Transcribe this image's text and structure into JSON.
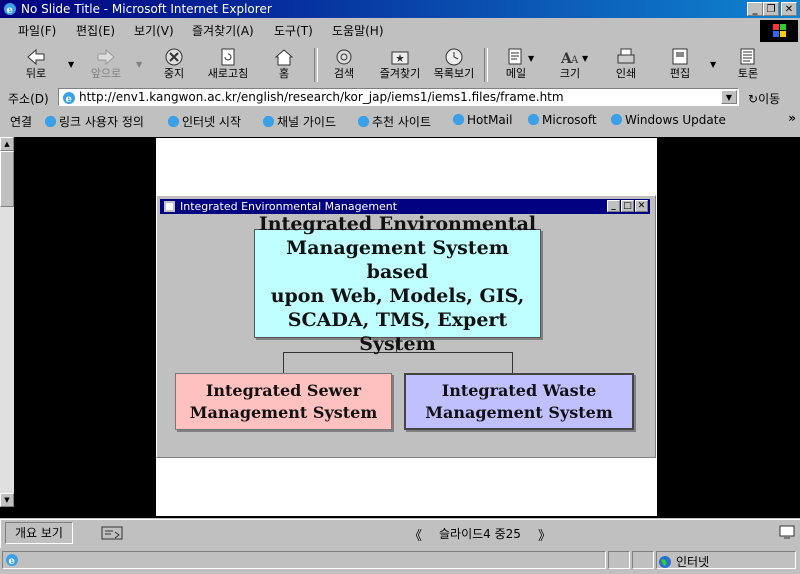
{
  "window": {
    "title": "No Slide Title - Microsoft Internet Explorer"
  },
  "menu": [
    {
      "label": "파일(F)"
    },
    {
      "label": "편집(E)"
    },
    {
      "label": "보기(V)"
    },
    {
      "label": "즐겨찾기(A)"
    },
    {
      "label": "도구(T)"
    },
    {
      "label": "도움말(H)"
    }
  ],
  "toolbar": [
    {
      "label": "뒤로",
      "icon": "back-arrow-icon"
    },
    {
      "label": "앞으로",
      "icon": "forward-arrow-icon",
      "disabled": true
    },
    {
      "label": "중지",
      "icon": "stop-icon"
    },
    {
      "label": "새로고침",
      "icon": "refresh-icon"
    },
    {
      "label": "홈",
      "icon": "home-icon"
    },
    {
      "label": "검색",
      "icon": "search-icon"
    },
    {
      "label": "즐겨찾기",
      "icon": "favorites-icon"
    },
    {
      "label": "목록보기",
      "icon": "history-icon"
    },
    {
      "label": "메일",
      "icon": "mail-icon"
    },
    {
      "label": "크기",
      "icon": "font-size-icon"
    },
    {
      "label": "인쇄",
      "icon": "print-icon"
    },
    {
      "label": "편집",
      "icon": "edit-icon"
    },
    {
      "label": "토론",
      "icon": "discuss-icon"
    }
  ],
  "address": {
    "label": "주소(D)",
    "url": "http://env1.kangwon.ac.kr/english/research/kor_jap/iems1/iems1.files/frame.htm",
    "go_label": "이동"
  },
  "links": {
    "label": "연결",
    "items": [
      {
        "label": "링크 사용자 정의"
      },
      {
        "label": "인터넷 시작"
      },
      {
        "label": "채널 가이드"
      },
      {
        "label": "추천 사이트"
      },
      {
        "label": "HotMail"
      },
      {
        "label": "Microsoft"
      },
      {
        "label": "Windows Update"
      }
    ],
    "more": "»"
  },
  "slide": {
    "window_title": "Integrated Environmental  Management",
    "top_box": [
      "Integrated Environmental",
      "Management System based",
      "upon Web, Models, GIS,",
      "SCADA, TMS, Expert System"
    ],
    "left_box": [
      "Integrated Sewer",
      "Management System"
    ],
    "right_box": [
      "Integrated Waste",
      "Management System"
    ]
  },
  "slide_bar": {
    "outline_tab": "개요 보기",
    "prev": "《",
    "counter": "슬라이드4 중25",
    "next": "》"
  },
  "status": {
    "zone": "인터넷"
  },
  "colors": {
    "top_box": "#c0ffff",
    "left_box": "#ffc0c0",
    "right_box": "#c0c0ff",
    "title_bar": "#000080"
  }
}
